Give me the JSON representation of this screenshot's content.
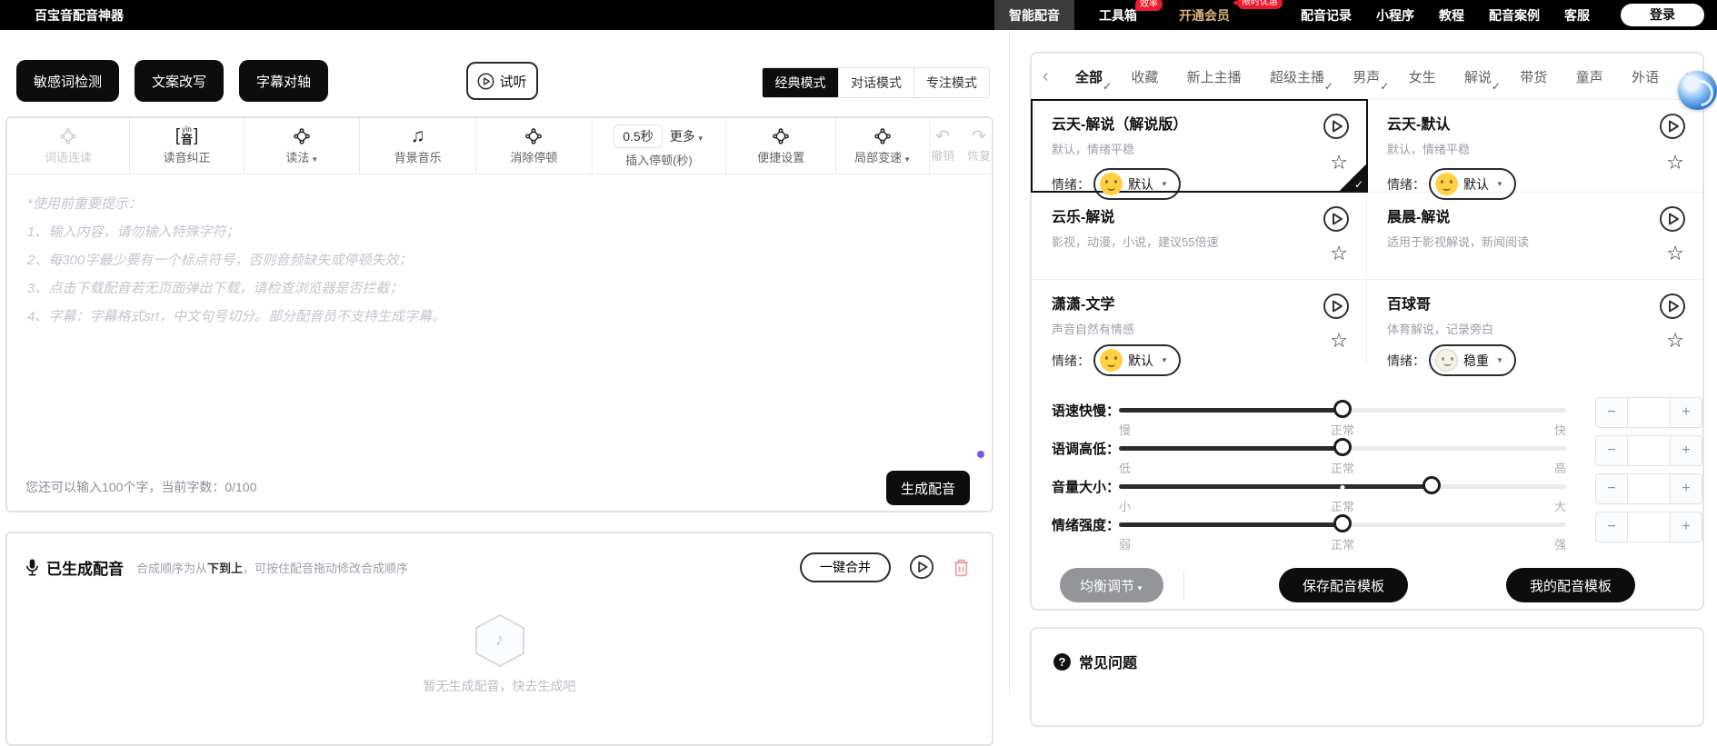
{
  "icons": {
    "star": "☆",
    "undo": "↶",
    "redo": "↷",
    "music_note": "♫",
    "note": "♪",
    "chevron_left": "‹",
    "chevron_right": "›",
    "caret": "▼",
    "check": "✓",
    "question": "?",
    "minus": "−",
    "plus": "+"
  },
  "colors": {
    "accent_black": "#0d0d0d",
    "badge_red": "#ee1c2e",
    "vip_gold": "#d7b37a",
    "trash_red": "#f19a9a",
    "purple_dot": "#6c5ce7"
  },
  "navbar": {
    "title": "百宝音配音神器",
    "items": [
      {
        "label": "智能配音"
      },
      {
        "label": "工具箱",
        "badge": "效率"
      },
      {
        "label": "开通会员",
        "badge": "限时优惠"
      },
      {
        "label": "配音记录"
      },
      {
        "label": "小程序"
      },
      {
        "label": "教程"
      },
      {
        "label": "配音案例"
      },
      {
        "label": "客服"
      }
    ],
    "login_label": "登录"
  },
  "editor": {
    "top_buttons": [
      "敏感词检测",
      "文案改写",
      "字幕对轴"
    ],
    "preview_button": "试听",
    "mode_tabs": [
      "经典模式",
      "对话模式",
      "专注模式"
    ],
    "toolbar": [
      {
        "label": "词语连读"
      },
      {
        "label": "读音纠正"
      },
      {
        "label": "读法"
      },
      {
        "label": "背景音乐"
      },
      {
        "label": "消除停顿"
      },
      {
        "label": "插入停顿(秒)"
      },
      {
        "label": "便捷设置"
      },
      {
        "label": "局部变速"
      }
    ],
    "yin_pinyin": "yīn",
    "yin_char": "音",
    "bracket_open": "[",
    "bracket_close": "]",
    "pause_value": "0.5秒",
    "more_label": "更多",
    "undo_label": "撤销",
    "redo_label": "恢复",
    "tips_text": "*使用前重要提示：\n1、输入内容，请勿输入特殊字符；\n2、每300字最少要有一个标点符号，否则音频缺失或停顿失效；\n3、点击下载配音若无页面弹出下载，请检查浏览器是否拦截；\n4、字幕：字幕格式srt，中文句号切分。部分配音员不支持生成字幕。",
    "char_counter": "您还可以输入100个字，当前字数：0/100",
    "generate_button": "生成配音"
  },
  "generated": {
    "title": "已生成配音",
    "note_prefix": "合成顺序为从",
    "note_em": "下到上",
    "note_suffix": "，可按住配音拖动修改合成顺序",
    "merge_button": "一键合并",
    "empty_text": "暂无生成配音，快去生成吧"
  },
  "voices": {
    "categories": [
      "全部",
      "收藏",
      "新上主播",
      "超级主播",
      "男声",
      "女生",
      "解说",
      "带货",
      "童声",
      "外语"
    ],
    "emotion_label": "情绪：",
    "cards": [
      {
        "name": "云天-解说（解说版）",
        "desc": "默认，情绪平稳",
        "emotion": "默认"
      },
      {
        "name": "云天-默认",
        "desc": "默认，情绪平稳",
        "emotion": "默认"
      },
      {
        "name": "云乐-解说",
        "desc": "影视，动漫，小说，建议55倍速"
      },
      {
        "name": "晨晨-解说",
        "desc": "适用于影视解说，新闻阅读"
      },
      {
        "name": "潇潇-文学",
        "desc": "声音自然有情感",
        "emotion": "默认"
      },
      {
        "name": "百球哥",
        "desc": "体育解说，记录旁白",
        "emotion": "稳重"
      }
    ],
    "sliders": [
      {
        "label": "语速快慢：",
        "min": "慢",
        "mid": "正常",
        "max": "快"
      },
      {
        "label": "语调高低：",
        "min": "低",
        "mid": "正常",
        "max": "高"
      },
      {
        "label": "音量大小：",
        "min": "小",
        "mid": "正常",
        "max": "大"
      },
      {
        "label": "情绪强度：",
        "min": "弱",
        "mid": "正常",
        "max": "强"
      }
    ],
    "balance_button": "均衡调节",
    "save_button": "保存配音模板",
    "my_button": "我的配音模板"
  },
  "faq": {
    "title": "常见问题"
  }
}
